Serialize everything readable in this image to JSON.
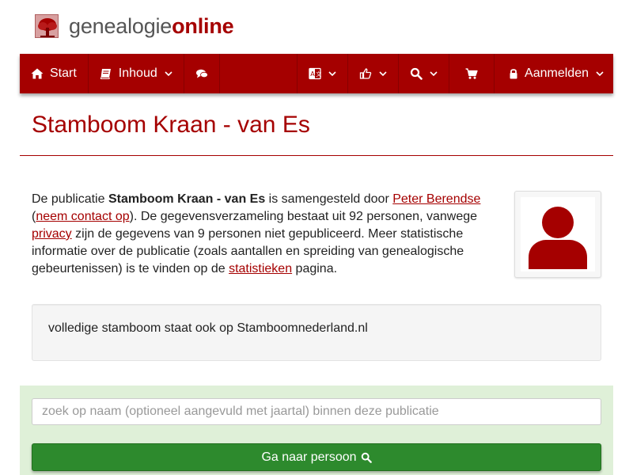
{
  "brand": {
    "part1": "genealogie",
    "part2": "online",
    "logo_icon": "tree-icon"
  },
  "nav": {
    "start_label": "Start",
    "contents_label": "Inhoud",
    "chat_icon": "comments-icon",
    "language_icon": "language-icon",
    "thumb_icon": "thumbs-up-icon",
    "search_icon": "search-icon",
    "cart_icon": "cart-icon",
    "login_label": "Aanmelden"
  },
  "page": {
    "title": "Stamboom Kraan - van Es"
  },
  "description": {
    "p1": "De publicatie ",
    "pub_name": "Stamboom Kraan - van Es",
    "p2": " is samengesteld door ",
    "author_link": "Peter Berendse",
    "p3": "(",
    "contact_link": "neem contact op",
    "p4": "). De gegevensverzameling bestaat uit 92 personen, vanwege ",
    "privacy_link": "privacy",
    "p5": " zijn de gegevens van 9 personen niet gepubliceerd. Meer statistische informatie over de publicatie (zoals aantallen en spreiding van genealogische gebeurtenissen) is te vinden op de ",
    "stats_link": "statistieken",
    "p6": " pagina."
  },
  "note": {
    "text": "volledige stamboom staat ook op Stamboomnederland.nl"
  },
  "search": {
    "placeholder": "zoek op naam (optioneel aangevuld met jaartal) binnen deze publicatie",
    "button_label": "Ga naar persoon"
  },
  "colors": {
    "brand_red": "#a50000",
    "panel_green": "#dff0d8",
    "button_green": "#2d8a2d"
  }
}
